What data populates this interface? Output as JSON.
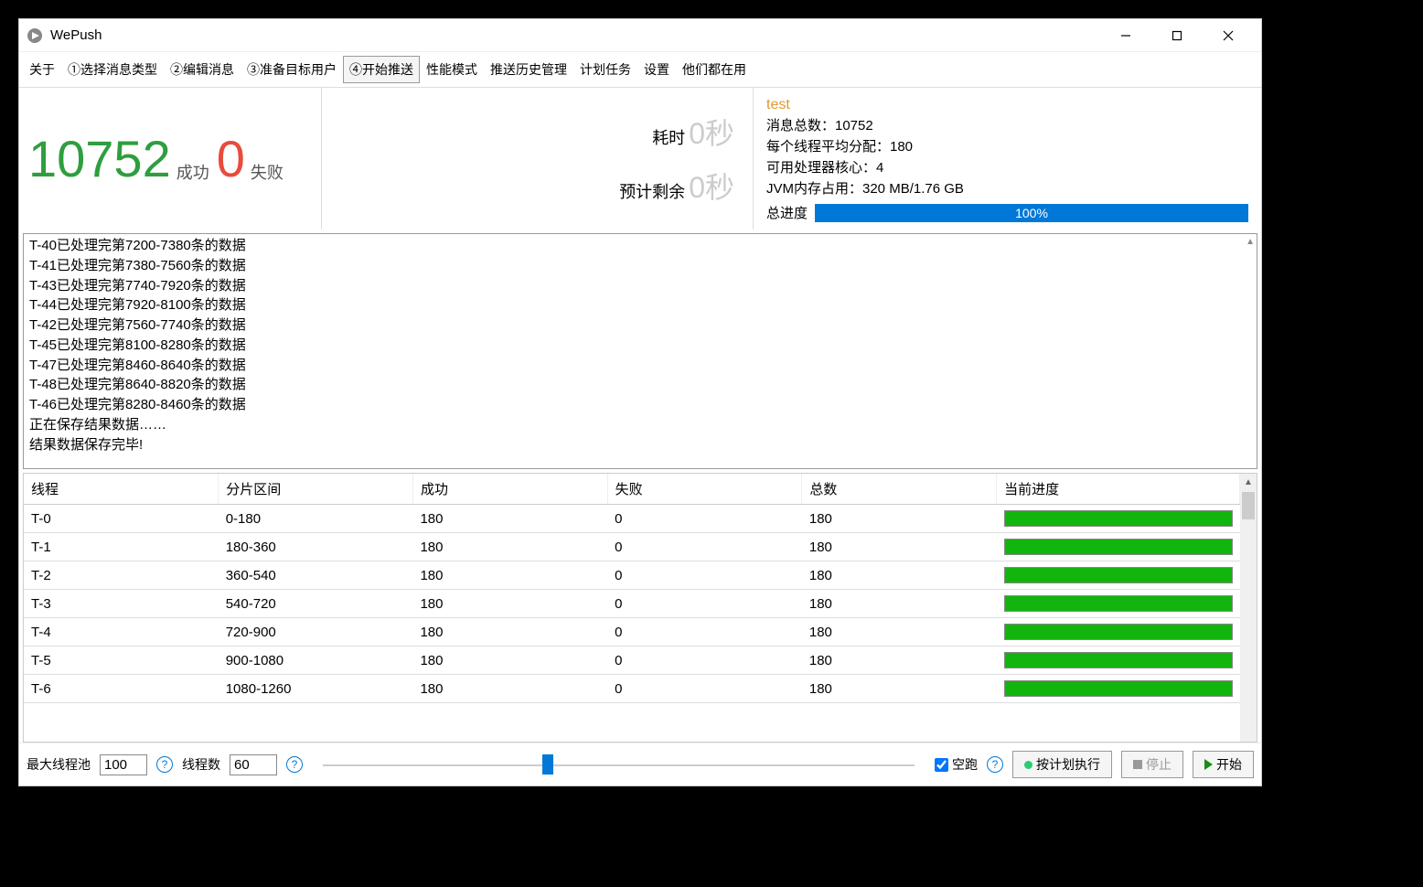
{
  "window": {
    "title": "WePush"
  },
  "menu": {
    "items": [
      "关于",
      "①选择消息类型",
      "②编辑消息",
      "③准备目标用户",
      "④开始推送",
      "性能模式",
      "推送历史管理",
      "计划任务",
      "设置",
      "他们都在用"
    ],
    "active_index": 4
  },
  "stats": {
    "success_count": "10752",
    "success_label": "成功",
    "fail_count": "0",
    "fail_label": "失败",
    "elapsed_label": "耗时",
    "elapsed_value": "0秒",
    "remain_label": "预计剩余",
    "remain_value": "0秒"
  },
  "info": {
    "title": "test",
    "lines": {
      "total": "消息总数：10752",
      "perthread": "每个线程平均分配：180",
      "cores": "可用处理器核心：4",
      "jvm": "JVM内存占用：320 MB/1.76 GB"
    },
    "progress_label": "总进度",
    "progress_text": "100%"
  },
  "log": [
    "T-40已处理完第7200-7380条的数据",
    "T-41已处理完第7380-7560条的数据",
    "T-43已处理完第7740-7920条的数据",
    "T-44已处理完第7920-8100条的数据",
    "T-42已处理完第7560-7740条的数据",
    "T-45已处理完第8100-8280条的数据",
    "T-47已处理完第8460-8640条的数据",
    "T-48已处理完第8640-8820条的数据",
    "T-46已处理完第8280-8460条的数据",
    "正在保存结果数据……",
    "结果数据保存完毕!"
  ],
  "table": {
    "headers": [
      "线程",
      "分片区间",
      "成功",
      "失败",
      "总数",
      "当前进度"
    ],
    "rows": [
      {
        "thread": "T-0",
        "range": "0-180",
        "succ": "180",
        "fail": "0",
        "total": "180"
      },
      {
        "thread": "T-1",
        "range": "180-360",
        "succ": "180",
        "fail": "0",
        "total": "180"
      },
      {
        "thread": "T-2",
        "range": "360-540",
        "succ": "180",
        "fail": "0",
        "total": "180"
      },
      {
        "thread": "T-3",
        "range": "540-720",
        "succ": "180",
        "fail": "0",
        "total": "180"
      },
      {
        "thread": "T-4",
        "range": "720-900",
        "succ": "180",
        "fail": "0",
        "total": "180"
      },
      {
        "thread": "T-5",
        "range": "900-1080",
        "succ": "180",
        "fail": "0",
        "total": "180"
      },
      {
        "thread": "T-6",
        "range": "1080-1260",
        "succ": "180",
        "fail": "0",
        "total": "180"
      }
    ]
  },
  "bottom": {
    "max_pool_label": "最大线程池",
    "max_pool_value": "100",
    "thread_count_label": "线程数",
    "thread_count_value": "60",
    "dryrun_label": "空跑",
    "dryrun_checked": true,
    "schedule_label": "按计划执行",
    "stop_label": "停止",
    "start_label": "开始"
  }
}
